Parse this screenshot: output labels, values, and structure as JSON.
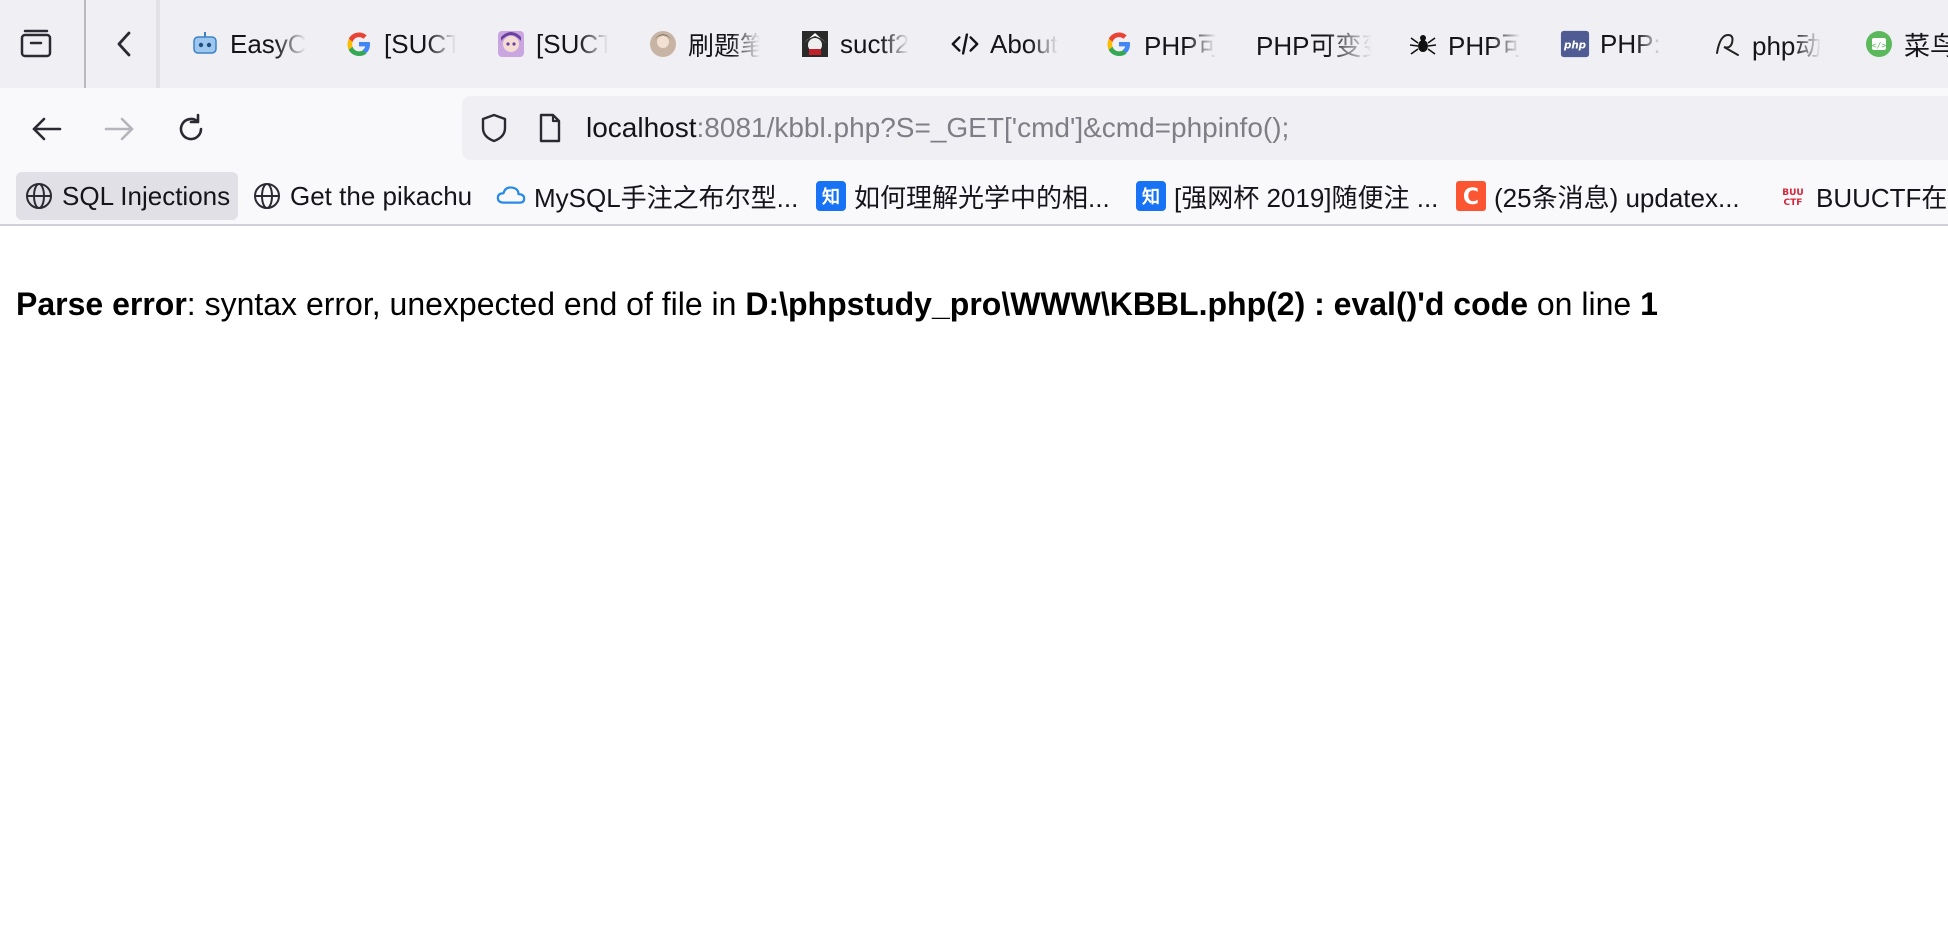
{
  "tabs": [
    {
      "title": "EasyC",
      "icon": "robot-icon"
    },
    {
      "title": "[SUCT",
      "icon": "google-icon"
    },
    {
      "title": "[SUCT",
      "icon": "anime-avatar-icon"
    },
    {
      "title": "刷题笔",
      "icon": "avatar-icon"
    },
    {
      "title": "suctf2",
      "icon": "anime-avatar-icon"
    },
    {
      "title": "About",
      "icon": "code-icon"
    },
    {
      "title": "PHP可",
      "icon": "google-icon"
    },
    {
      "title": "PHP可变变",
      "icon": ""
    },
    {
      "title": "PHP可",
      "icon": "spider-icon"
    },
    {
      "title": "PHP: ",
      "icon": "php-icon"
    },
    {
      "title": "php动",
      "icon": "logo-icon"
    },
    {
      "title": "菜鸟",
      "icon": "runoob-icon"
    }
  ],
  "navbar": {
    "url_host": "localhost",
    "url_rest": ":8081/kbbl.php?S=_GET['cmd']&cmd=phpinfo();"
  },
  "bookmarks": [
    {
      "label": "SQL Injections",
      "icon": "globe-icon"
    },
    {
      "label": "Get the pikachu",
      "icon": "globe-icon"
    },
    {
      "label": "MySQL手注之布尔型...",
      "icon": "cloud-icon"
    },
    {
      "label": "如何理解光学中的相...",
      "icon": "zhihu-icon"
    },
    {
      "label": "[强网杯 2019]随便注 ...",
      "icon": "zhihu-icon"
    },
    {
      "label": "(25条消息) updatex...",
      "icon": "csdn-icon"
    },
    {
      "label": "BUUCTF在线",
      "icon": "buuctf-icon"
    }
  ],
  "error": {
    "label": "Parse error",
    "message": ": syntax error, unexpected end of file in ",
    "file": "D:\\phpstudy_pro\\WWW\\KBBL.php(2) : eval()'d code",
    "on_line": " on line ",
    "line": "1"
  },
  "colors": {
    "tabstrip_bg": "#f0f0f4",
    "toolbar_bg": "#f9f9fb",
    "urlbar_bg": "#f0f0f4",
    "url_host": "#15141a",
    "url_rest": "#7f7e86"
  }
}
